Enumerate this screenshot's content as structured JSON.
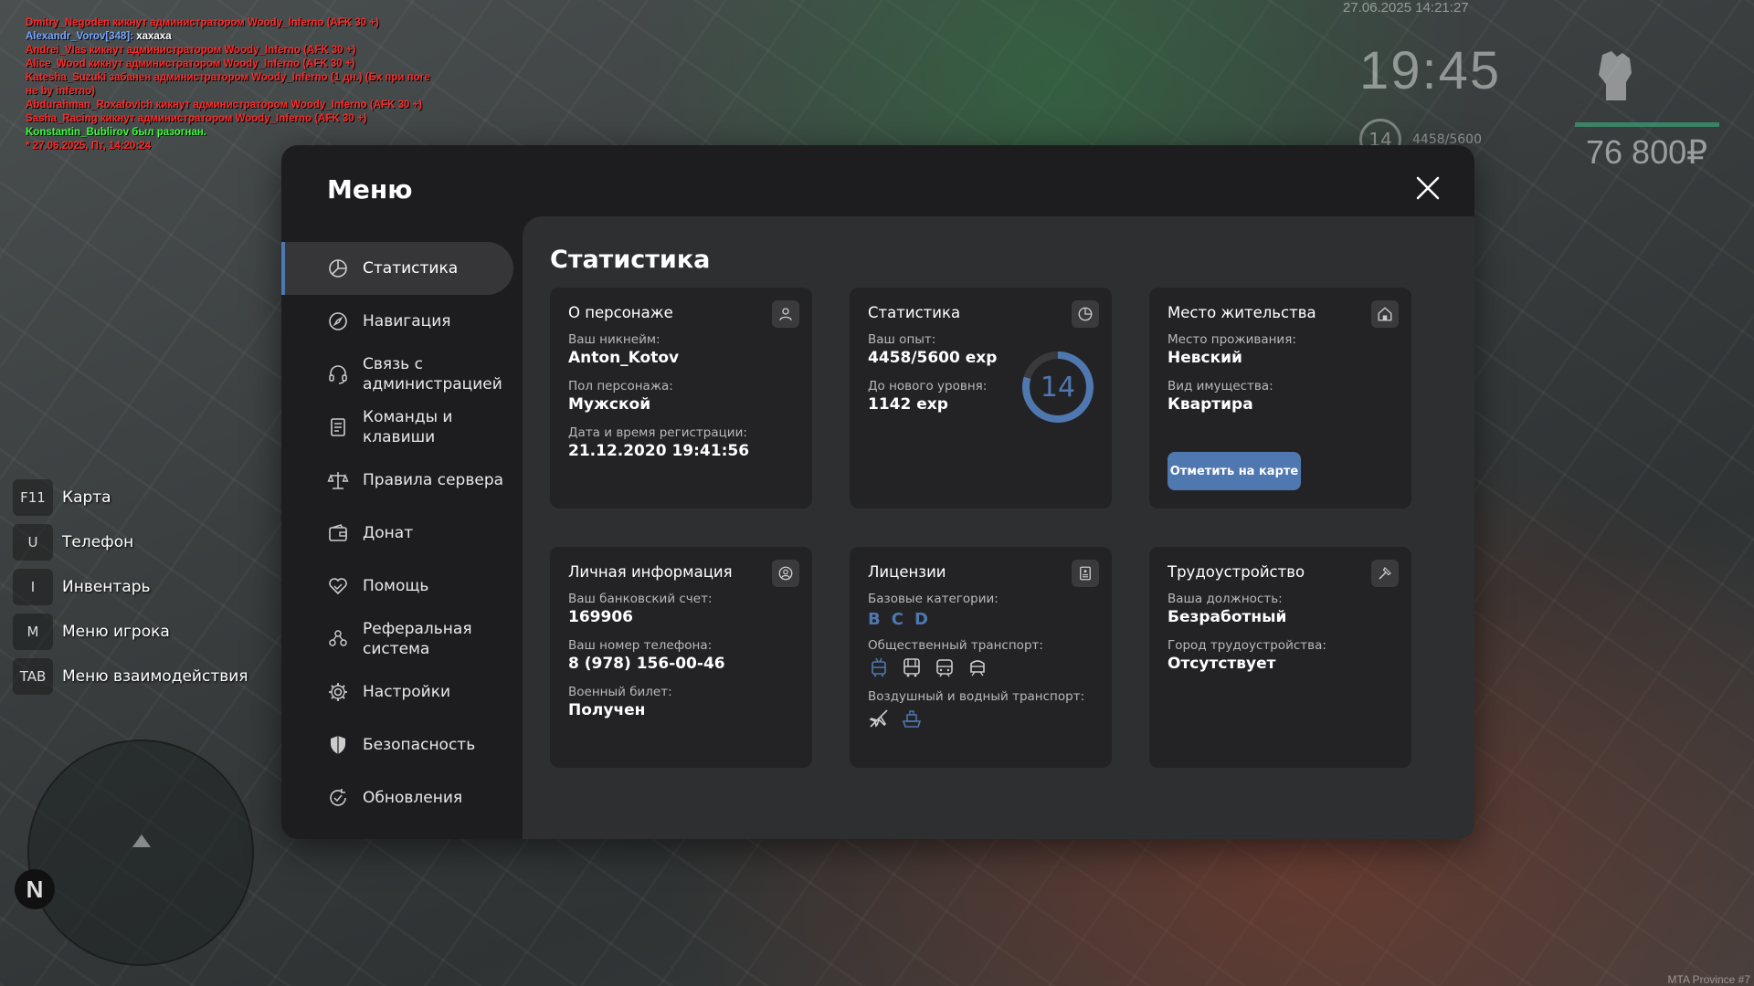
{
  "chat": {
    "lines": [
      {
        "text": "Dmitry_Negoden кикнут администратором Woody_Inferno (AFK 30 +)"
      },
      {
        "name": "Alexandr_Vorov[348]:",
        "msg": " хахаха"
      },
      {
        "text": "Andrei_Vlas кикнут администратором Woody_Inferno (AFK 30 +)"
      },
      {
        "text": "Alice_Wood кикнут администратором Woody_Inferno (AFK 30 +)"
      },
      {
        "text": "Katesha_Suzuki забанен администратором Woody_Inferno (1 дн.) (Бх при поге"
      },
      {
        "text": "не by inferno)"
      },
      {
        "text": "Abdurahman_Roxafovich кикнут администратором Woody_Inferno (AFK 30 +)"
      },
      {
        "text": "Sasha_Racing кикнут администратором Woody_Inferno (AFK 30 +)"
      },
      {
        "text": "Konstantin_Bublirov был разогнан."
      },
      {
        "text": "* 27.06.2025, Пт, 14:20:24"
      }
    ]
  },
  "hud": {
    "datetime": "27.06.2025 14:21:27",
    "clock": "19:45",
    "level": "14",
    "exp": "4458/5600",
    "money": "76 800₽"
  },
  "hotkeys": [
    {
      "key": "F11",
      "label": "Карта"
    },
    {
      "key": "U",
      "label": "Телефон"
    },
    {
      "key": "I",
      "label": "Инвентарь"
    },
    {
      "key": "M",
      "label": "Меню игрока"
    },
    {
      "key": "TAB",
      "label": "Меню взаимодействия"
    }
  ],
  "compass": "N",
  "watermark": "MTA Province #7",
  "menu": {
    "title": "Меню",
    "sidebar": [
      {
        "label": "Статистика",
        "icon": "chart-pie-icon",
        "active": true
      },
      {
        "label": "Навигация",
        "icon": "compass-icon"
      },
      {
        "label": "Связь с администрацией",
        "icon": "headset-icon"
      },
      {
        "label": "Команды и клавиши",
        "icon": "document-list-icon"
      },
      {
        "label": "Правила сервера",
        "icon": "scales-icon"
      },
      {
        "label": "Донат",
        "icon": "wallet-icon"
      },
      {
        "label": "Помощь",
        "icon": "heart-hand-icon"
      },
      {
        "label": "Реферальная система",
        "icon": "people-icon"
      },
      {
        "label": "Настройки",
        "icon": "gear-icon"
      },
      {
        "label": "Безопасность",
        "icon": "shield-icon"
      },
      {
        "label": "Обновления",
        "icon": "refresh-check-icon"
      }
    ],
    "content": {
      "title": "Статистика",
      "character": {
        "title": "О персонаже",
        "nickname_label": "Ваш никнейм:",
        "nickname": "Anton_Kotov",
        "gender_label": "Пол персонажа:",
        "gender": "Мужской",
        "reg_label": "Дата и время регистрации:",
        "reg": "21.12.2020 19:41:56"
      },
      "stats": {
        "title": "Статистика",
        "exp_label": "Ваш опыт:",
        "exp": "4458/5600 exp",
        "next_label": "До нового уровня:",
        "next": "1142 exp",
        "level": "14",
        "progress": 0.796
      },
      "residence": {
        "title": "Место жительства",
        "place_label": "Место проживания:",
        "place": "Невский",
        "property_label": "Вид имущества:",
        "property": "Квартира",
        "button": "Отметить на карте"
      },
      "personal": {
        "title": "Личная информация",
        "bank_label": "Ваш банковский счет:",
        "bank": "169906",
        "phone_label": "Ваш номер телефона:",
        "phone": "8 (978) 156-00-46",
        "military_label": "Военный билет:",
        "military": "Получен"
      },
      "licenses": {
        "title": "Лицензии",
        "base_label": "Базовые категории:",
        "categories": [
          "B",
          "C",
          "D"
        ],
        "public_label": "Общественный транспорт:",
        "air_label": "Воздушный и водный транспорт:"
      },
      "employment": {
        "title": "Трудоустройство",
        "position_label": "Ваша должность:",
        "position": "Безработный",
        "city_label": "Город трудоустройства:",
        "city": "Отсутствует"
      }
    }
  },
  "colors": {
    "accent": "#4f78b0",
    "panel": "#1d1d1f",
    "content": "#2e2f31",
    "card": "#232325"
  }
}
